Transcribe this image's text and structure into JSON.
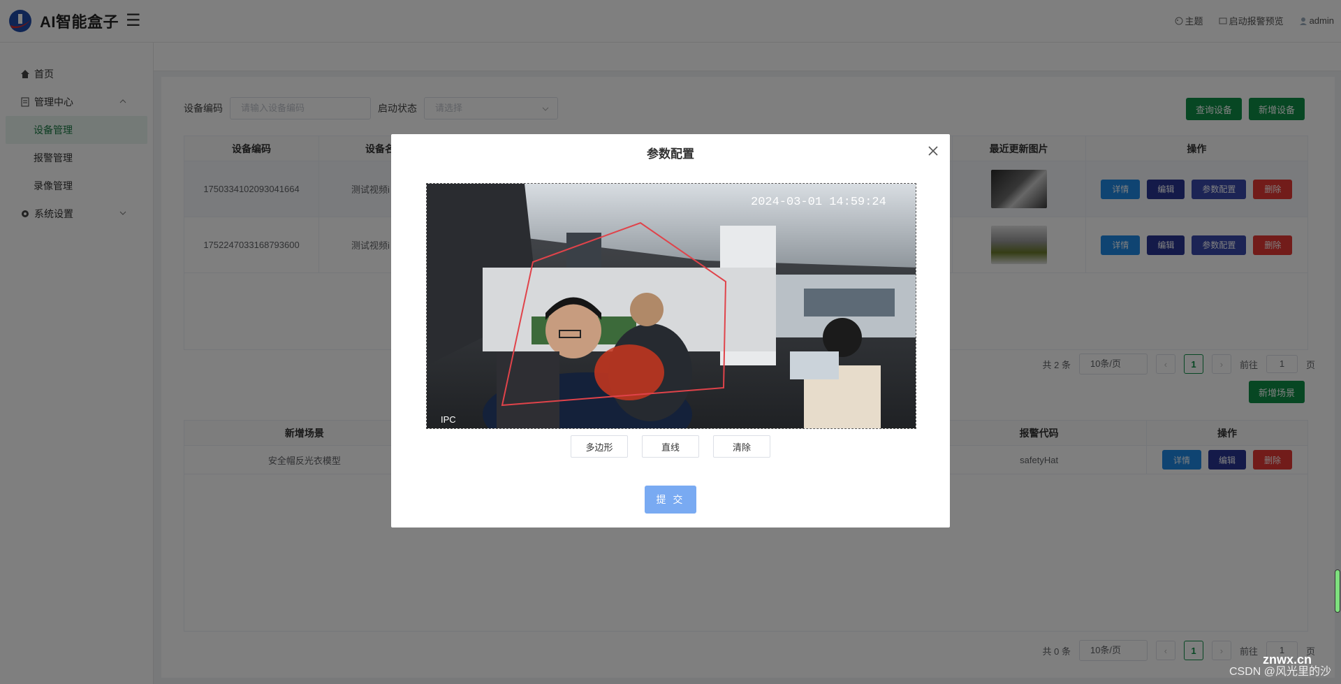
{
  "header": {
    "app_title": "AI智能盒子",
    "theme": "主题",
    "alarm_preview": "启动报警预览",
    "user": "admin"
  },
  "sidebar": {
    "items": [
      {
        "label": "首页"
      },
      {
        "label": "管理中心"
      },
      {
        "label": "设备管理"
      },
      {
        "label": "报警管理"
      },
      {
        "label": "录像管理"
      },
      {
        "label": "系统设置"
      }
    ]
  },
  "filter": {
    "device_code_label": "设备编码",
    "device_code_placeholder": "请输入设备编码",
    "status_label": "启动状态",
    "status_placeholder": "请选择",
    "query_button": "查询设备",
    "add_button": "新增设备"
  },
  "device_table": {
    "headers": [
      "设备编码",
      "设备名",
      "最近更新图片",
      "操作"
    ],
    "rows": [
      {
        "code": "1750334102093041664",
        "name": "测试视频i"
      },
      {
        "code": "1752247033168793600",
        "name": "测试视频i"
      }
    ],
    "actions": {
      "detail": "详情",
      "edit": "编辑",
      "config": "参数配置",
      "delete": "删除"
    }
  },
  "pager1": {
    "total": "共 2 条",
    "size": "10条/页",
    "page": "1",
    "goto": "前往",
    "goto_value": "1",
    "unit": "页"
  },
  "scene": {
    "add_button": "新增场景",
    "headers": [
      "新增场景",
      "报警代码",
      "操作"
    ],
    "rows": [
      {
        "name": "安全帽反光衣模型",
        "code": "safetyHat"
      }
    ]
  },
  "pager2": {
    "total": "共 0 条",
    "size": "10条/页",
    "page": "1",
    "goto": "前往",
    "goto_value": "1",
    "unit": "页"
  },
  "modal": {
    "title": "参数配置",
    "timestamp": "2024-03-01 14:59:24",
    "cam_label": "IPC",
    "tools": [
      "多边形",
      "直线",
      "清除"
    ],
    "submit": "提 交"
  },
  "watermark": {
    "logo": "znwx.cn",
    "text": "CSDN @风光里的沙"
  }
}
